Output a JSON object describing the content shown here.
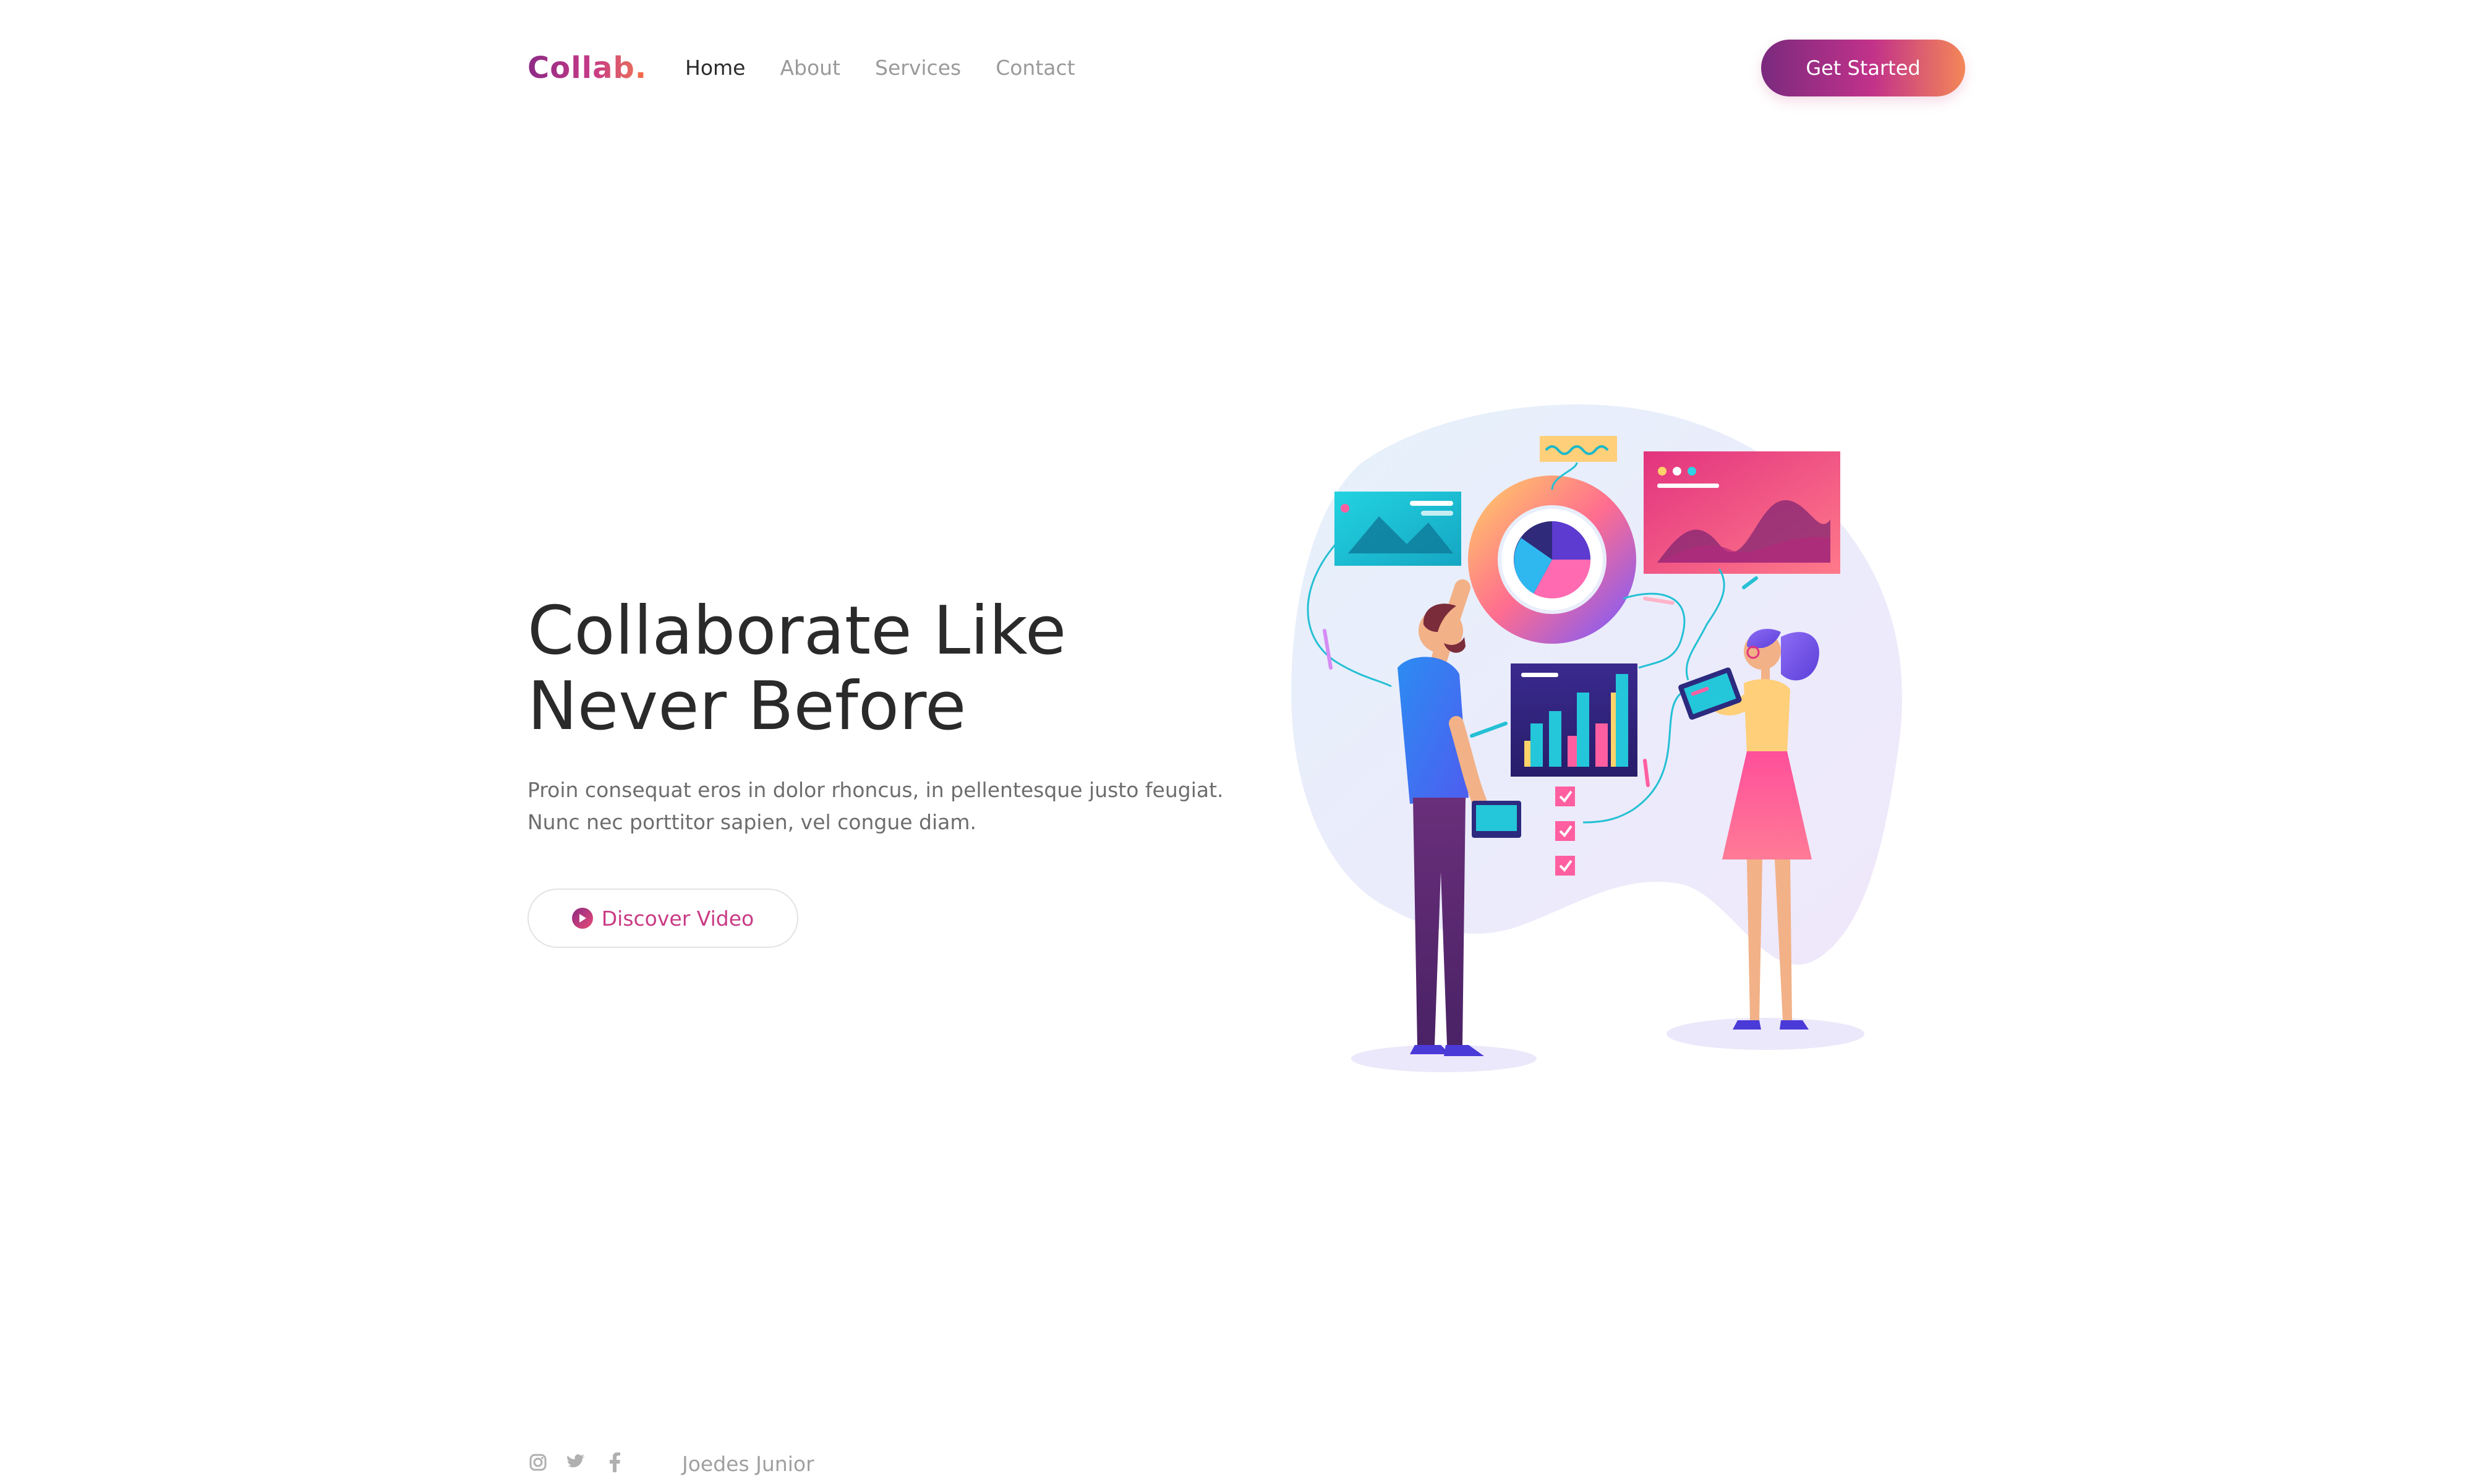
{
  "brand": {
    "logo_text": "Collab",
    "logo_dot": "."
  },
  "nav": {
    "items": [
      {
        "label": "Home",
        "active": true
      },
      {
        "label": "About",
        "active": false
      },
      {
        "label": "Services",
        "active": false
      },
      {
        "label": "Contact",
        "active": false
      }
    ],
    "cta_label": "Get Started"
  },
  "hero": {
    "title_line1": "Collaborate Like",
    "title_line2": "Never Before",
    "subtitle_line1": "Proin consequat eros in dolor rhoncus, in pellentesque justo feugiat.",
    "subtitle_line2": "Nunc nec porttitor sapien, vel congue diam.",
    "video_button_label": "Discover Video"
  },
  "footer": {
    "socials": [
      "instagram-icon",
      "twitter-icon",
      "facebook-icon"
    ],
    "author": "Joedes Junior"
  },
  "colors": {
    "brand_gradient_start": "#7a2a7e",
    "brand_gradient_mid": "#c2328a",
    "brand_gradient_end": "#f48757",
    "accent_pink": "#c93a84",
    "text_dark": "#2a2a2a",
    "text_muted": "#9a9a9a"
  }
}
